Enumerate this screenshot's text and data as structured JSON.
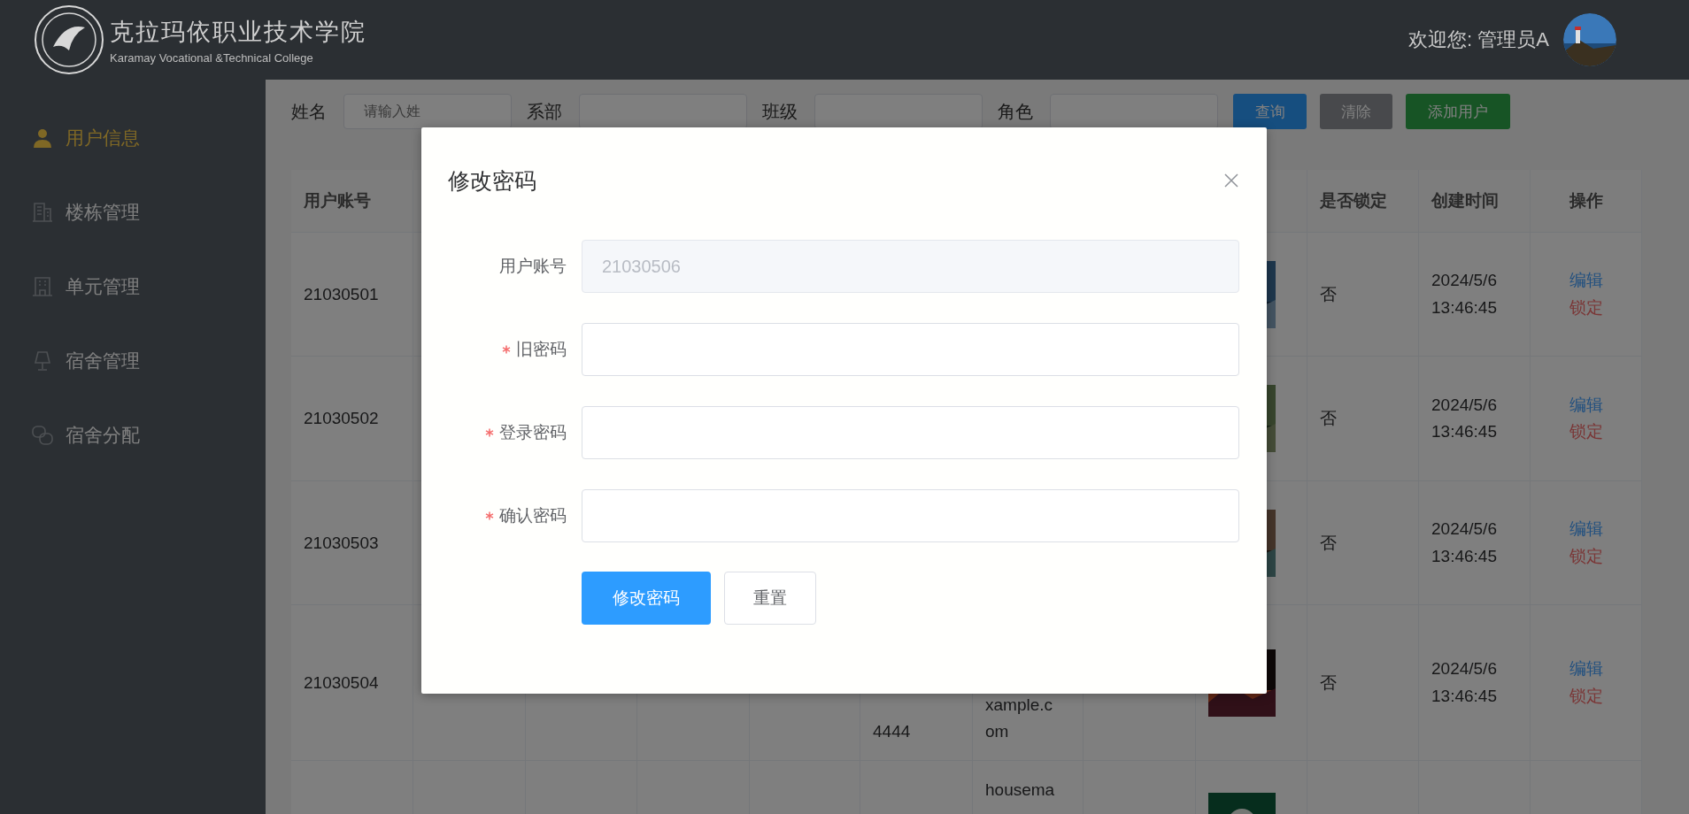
{
  "header": {
    "logo_title": "克拉玛依职业技术学院",
    "logo_subtitle": "Karamay Vocational &Technical College",
    "welcome": "欢迎您: 管理员A"
  },
  "sidebar": {
    "items": [
      {
        "label": "用户信息",
        "selected": true
      },
      {
        "label": "楼栋管理",
        "selected": false
      },
      {
        "label": "单元管理",
        "selected": false
      },
      {
        "label": "宿舍管理",
        "selected": false
      },
      {
        "label": "宿舍分配",
        "selected": false
      }
    ]
  },
  "filters": {
    "fields": [
      {
        "label": "姓名",
        "placeholder": "请输入姓"
      },
      {
        "label": "系部"
      },
      {
        "label": "班级"
      },
      {
        "label": "角色"
      }
    ],
    "buttons": [
      {
        "label": "查询",
        "kind": "primary"
      },
      {
        "label": "清除",
        "kind": "info"
      },
      {
        "label": "添加用户",
        "kind": "success"
      }
    ]
  },
  "table": {
    "columns": [
      "用户账号",
      "是否锁定",
      "创建时间",
      "操作"
    ],
    "rows": [
      {
        "account": "21030501",
        "locked": "否",
        "created": "2024/5/6 13:46:45",
        "actions": [
          "编辑",
          "锁定"
        ]
      },
      {
        "account": "21030502",
        "locked": "否",
        "created": "2024/5/6 13:46:45",
        "actions": [
          "编辑",
          "锁定"
        ]
      },
      {
        "account": "21030503",
        "locked": "否",
        "created": "2024/5/6 13:46:45",
        "actions": [
          "编辑",
          "锁定"
        ]
      },
      {
        "account": "21030504",
        "phone": "4444",
        "email_lines": [
          "xample.c",
          "om"
        ],
        "locked": "否",
        "created": "2024/5/6 13:46:45",
        "actions": [
          "编辑",
          "锁定"
        ]
      },
      {
        "email_lines": [
          "housema"
        ]
      }
    ]
  },
  "dialog": {
    "title": "修改密码",
    "fields": [
      {
        "label": "用户账号",
        "value": "21030506",
        "required": false,
        "disabled": true
      },
      {
        "label": "旧密码",
        "required": true,
        "disabled": false
      },
      {
        "label": "登录密码",
        "required": true,
        "disabled": false
      },
      {
        "label": "确认密码",
        "required": true,
        "disabled": false
      }
    ],
    "buttons": [
      {
        "label": "修改密码",
        "kind": "primary"
      },
      {
        "label": "重置",
        "kind": "default"
      }
    ]
  }
}
